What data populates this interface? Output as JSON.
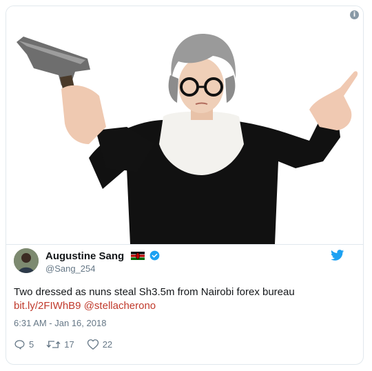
{
  "tweet": {
    "author_name": "Augustine Sang",
    "author_handle": "@Sang_254",
    "text": "Two dressed as nuns steal Sh3.5m from Nairobi forex bureau",
    "link_text": "bit.ly/2FIWhB9",
    "mention_text": "@stellacherono",
    "timestamp": "6:31 AM - Jan 16, 2018",
    "replies": "5",
    "retweets": "17",
    "likes": "22"
  },
  "icons": {
    "info": "info-icon",
    "flag": "kenya-flag-icon",
    "verified": "verified-badge-icon",
    "brand": "twitter-bird-icon",
    "reply": "reply-icon",
    "retweet": "retweet-icon",
    "like": "heart-icon"
  },
  "colors": {
    "link": "#c0392b",
    "twitter_blue": "#1da1f2",
    "muted": "#657786"
  }
}
